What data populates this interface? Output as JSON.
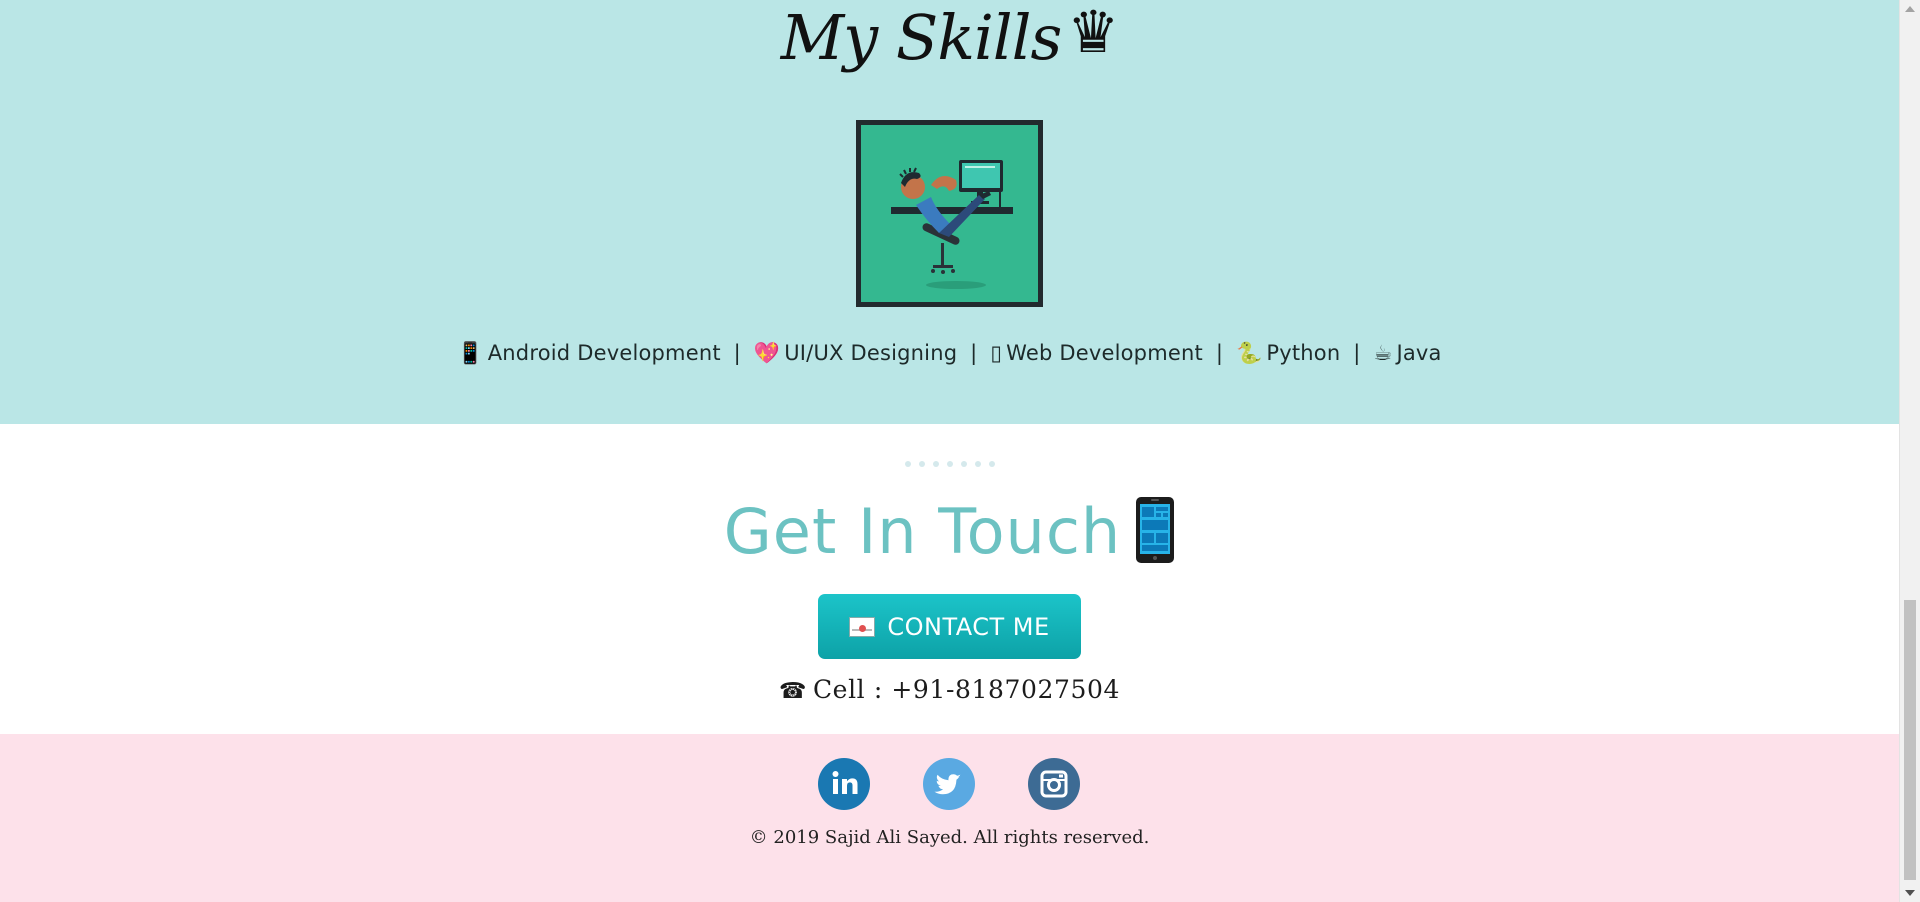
{
  "skills": {
    "title": "My Skills",
    "title_icon": "crown-icon",
    "image_icon": "developer-illustration",
    "items": [
      {
        "icon": "📱",
        "icon_name": "mobile-phone-icon",
        "label": "Android Development"
      },
      {
        "icon": "💖",
        "icon_name": "heart-icon",
        "label": "UI/UX Designing"
      },
      {
        "icon": "▯",
        "icon_name": "web-icon",
        "label": "Web Development"
      },
      {
        "icon": "🐍",
        "icon_name": "snake-icon",
        "label": "Python"
      },
      {
        "icon": "☕",
        "icon_name": "coffee-icon",
        "label": "Java"
      }
    ],
    "separator": "|"
  },
  "contact": {
    "title": "Get In Touch",
    "title_icon": "smartphone-icon",
    "button_label": "CONTACT ME",
    "button_icon": "envelope-icon",
    "cell_label": "Cell : +91-8187027504",
    "cell_icon": "telephone-icon"
  },
  "footer": {
    "social": [
      {
        "name": "linkedin",
        "icon": "linkedin-icon"
      },
      {
        "name": "twitter",
        "icon": "twitter-icon"
      },
      {
        "name": "instagram",
        "icon": "instagram-icon"
      }
    ],
    "copyright": "© 2019 Sajid Ali Sayed. All rights reserved."
  },
  "colors": {
    "skills_bg": "#bae6e6",
    "footer_bg": "#fde1ea",
    "accent": "#6cc2c2",
    "button": "#10b2b8"
  }
}
